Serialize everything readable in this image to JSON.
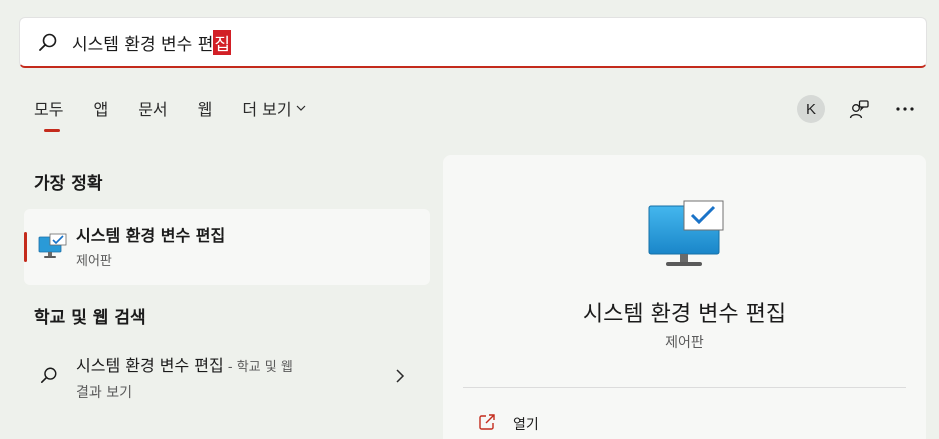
{
  "search": {
    "query_prefix": "시스템 환경 변수 편",
    "query_last_char": "집"
  },
  "tabs": [
    {
      "label": "모두",
      "active": true
    },
    {
      "label": "앱"
    },
    {
      "label": "문서"
    },
    {
      "label": "웹"
    },
    {
      "label": "더 보기"
    }
  ],
  "header_tools": {
    "avatar_initial": "K",
    "icons": [
      "feedback-icon",
      "more-icon"
    ]
  },
  "best_match": {
    "section_title": "가장 정확",
    "title": "시스템 환경 변수 편집",
    "subtitle": "제어판",
    "icon": "system-properties-monitor-icon"
  },
  "web_search": {
    "section_title": "학교 및 웹 검색",
    "title": "시스템 환경 변수 편집",
    "title_suffix": " - 학교 및 웹",
    "subtitle": "결과 보기"
  },
  "detail": {
    "title": "시스템 환경 변수 편집",
    "subtitle": "제어판",
    "actions": [
      {
        "label": "열기",
        "icon": "open-external-icon"
      }
    ]
  },
  "colors": {
    "accent": "#c42b1c",
    "background": "#eef1ec",
    "panel": "#f7f8f6"
  }
}
